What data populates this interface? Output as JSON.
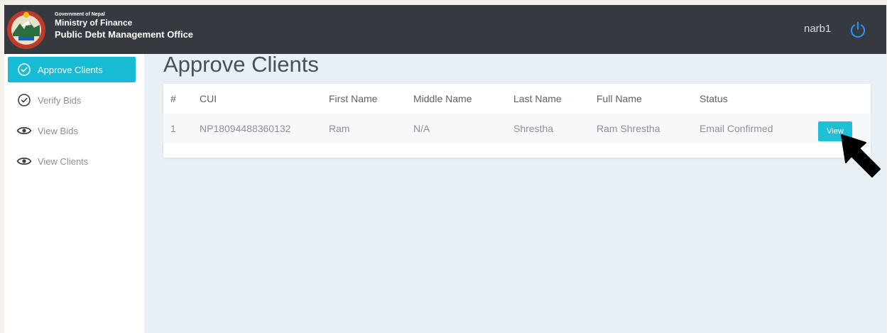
{
  "header": {
    "gov_label": "Government of Nepal",
    "ministry_label": "Ministry of Finance",
    "office_label": "Public Debt Management Office",
    "username": "narb1"
  },
  "sidebar": {
    "items": [
      {
        "label": "Approve Clients",
        "icon": "check-circle-icon",
        "active": true
      },
      {
        "label": "Verify Bids",
        "icon": "check-circle-icon",
        "active": false
      },
      {
        "label": "View Bids",
        "icon": "eye-icon",
        "active": false
      },
      {
        "label": "View Clients",
        "icon": "eye-icon",
        "active": false
      }
    ]
  },
  "main": {
    "title": "Approve Clients",
    "table": {
      "columns": [
        "#",
        "CUI",
        "First Name",
        "Middle Name",
        "Last Name",
        "Full Name",
        "Status"
      ],
      "rows": [
        {
          "index": "1",
          "cui": "NP18094488360132",
          "first_name": "Ram",
          "middle_name": "N/A",
          "last_name": "Shrestha",
          "full_name": "Ram Shrestha",
          "status": "Email Confirmed",
          "action": "View"
        }
      ]
    }
  },
  "colors": {
    "topbar": "#343a40",
    "accent": "#17bcd4",
    "background": "#e9f0f5"
  }
}
